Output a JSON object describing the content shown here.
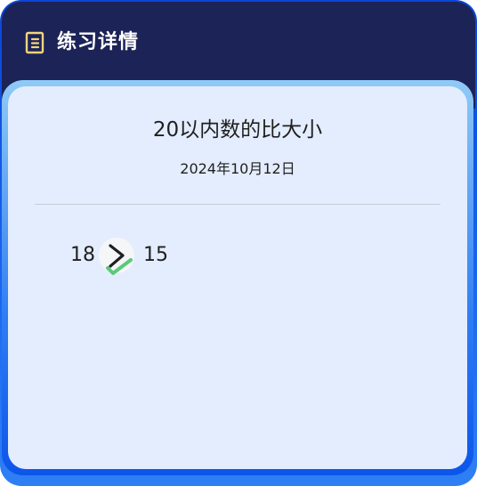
{
  "header": {
    "icon": "document-icon",
    "title": "练习详情"
  },
  "exercise": {
    "title": "20以内数的比大小",
    "date": "2024年10月12日"
  },
  "questions": [
    {
      "left": "18",
      "answer_symbol": ">",
      "right": "15",
      "result": "correct"
    }
  ],
  "colors": {
    "header_bg": "#1c2357",
    "card_bg": "#e4edfd",
    "accent_blue": "#1a67f0",
    "icon_yellow": "#f4d47c",
    "check_green": "#5cc97a"
  }
}
